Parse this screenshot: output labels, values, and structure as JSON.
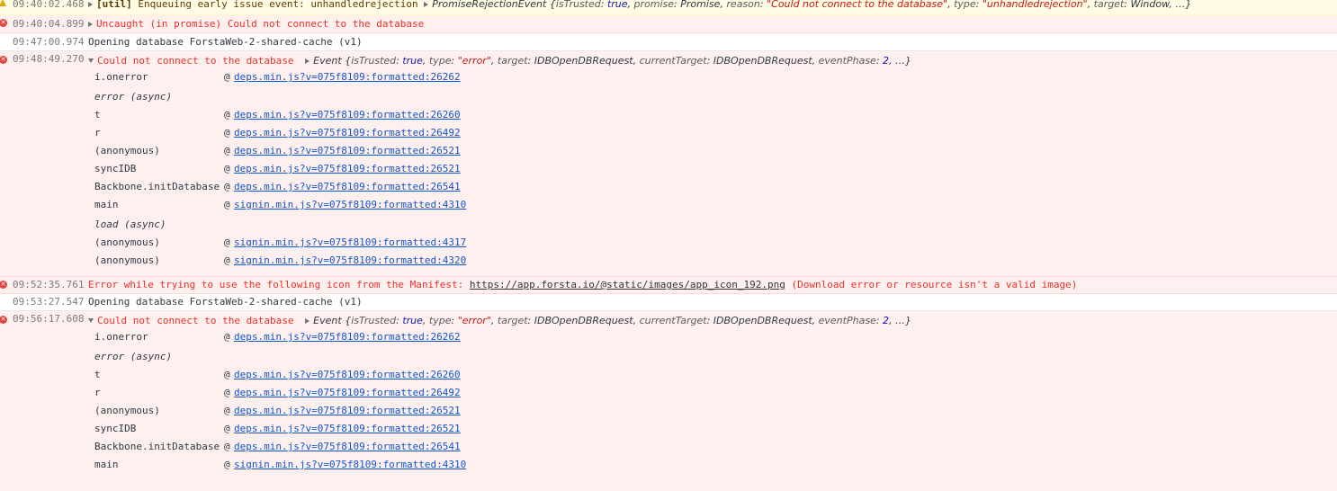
{
  "messages": [
    {
      "level": "warning",
      "timestamp": "09:40:02.468",
      "prefix": "[util]",
      "text": " Enqueuing early issue event: unhandledrejection ",
      "object_preview": {
        "type": "PromiseRejectionEvent",
        "open": " {",
        "k1": "isTrusted",
        "v1": "true",
        "k2": "promise",
        "v2": "Promise",
        "k3": "reason",
        "v3": "\"Could not connect to the database\"",
        "k4": "type",
        "v4": "\"unhandledrejection\"",
        "k5": "target",
        "v5": "Window",
        "close": ", …}"
      }
    },
    {
      "level": "error",
      "timestamp": "09:40:04.899",
      "text": "Uncaught (in promise) Could not connect to the database"
    },
    {
      "level": "info",
      "timestamp": "09:47:00.974",
      "text": "Opening database ForstaWeb-2-shared-cache (v1)"
    },
    {
      "level": "error",
      "timestamp": "09:48:49.270",
      "text": "Could not connect to the database",
      "event_preview": {
        "type": "Event",
        "k1": "isTrusted",
        "v1": "true",
        "k2": "type",
        "v2": "\"error\"",
        "k3": "target",
        "v3": "IDBOpenDBRequest",
        "k4": "currentTarget",
        "v4": "IDBOpenDBRequest",
        "k5": "eventPhase",
        "v5": "2",
        "close": ", …}"
      },
      "stack": [
        {
          "fn": "i.onerror",
          "link": "deps.min.js?v=075f8109:formatted:26262"
        },
        {
          "async": "error (async)"
        },
        {
          "fn": "t",
          "link": "deps.min.js?v=075f8109:formatted:26260"
        },
        {
          "fn": "r",
          "link": "deps.min.js?v=075f8109:formatted:26492"
        },
        {
          "fn": "(anonymous)",
          "link": "deps.min.js?v=075f8109:formatted:26521"
        },
        {
          "fn": "syncIDB",
          "link": "deps.min.js?v=075f8109:formatted:26521"
        },
        {
          "fn": "Backbone.initDatabase",
          "link": "deps.min.js?v=075f8109:formatted:26541"
        },
        {
          "fn": "main",
          "link": "signin.min.js?v=075f8109:formatted:4310"
        },
        {
          "async": "load (async)"
        },
        {
          "fn": "(anonymous)",
          "link": "signin.min.js?v=075f8109:formatted:4317"
        },
        {
          "fn": "(anonymous)",
          "link": "signin.min.js?v=075f8109:formatted:4320"
        }
      ]
    },
    {
      "level": "error",
      "timestamp": "09:52:35.761",
      "text_before": "Error while trying to use the following icon from the Manifest: ",
      "url": "https://app.forsta.io/@static/images/app_icon_192.png",
      "text_after": " (Download error or resource isn't a valid image)"
    },
    {
      "level": "info",
      "timestamp": "09:53:27.547",
      "text": "Opening database ForstaWeb-2-shared-cache (v1)"
    },
    {
      "level": "error",
      "timestamp": "09:56:17.608",
      "text": "Could not connect to the database",
      "event_preview": {
        "type": "Event",
        "k1": "isTrusted",
        "v1": "true",
        "k2": "type",
        "v2": "\"error\"",
        "k3": "target",
        "v3": "IDBOpenDBRequest",
        "k4": "currentTarget",
        "v4": "IDBOpenDBRequest",
        "k5": "eventPhase",
        "v5": "2",
        "close": ", …}"
      },
      "stack": [
        {
          "fn": "i.onerror",
          "link": "deps.min.js?v=075f8109:formatted:26262"
        },
        {
          "async": "error (async)"
        },
        {
          "fn": "t",
          "link": "deps.min.js?v=075f8109:formatted:26260"
        },
        {
          "fn": "r",
          "link": "deps.min.js?v=075f8109:formatted:26492"
        },
        {
          "fn": "(anonymous)",
          "link": "deps.min.js?v=075f8109:formatted:26521"
        },
        {
          "fn": "syncIDB",
          "link": "deps.min.js?v=075f8109:formatted:26521"
        },
        {
          "fn": "Backbone.initDatabase",
          "link": "deps.min.js?v=075f8109:formatted:26541"
        },
        {
          "fn": "main",
          "link": "signin.min.js?v=075f8109:formatted:4310"
        }
      ]
    }
  ],
  "colors": {
    "error_bg": "#fff0f0",
    "warning_bg": "#fffbe5",
    "error_text": "#e8322a",
    "link": "#1155cc"
  },
  "icons": {
    "error": "error-circle-icon",
    "warning": "warning-triangle-icon",
    "expand": "triangle-right-icon",
    "collapse": "triangle-down-icon"
  },
  "at_symbol": "@",
  "error_glyph": "✕"
}
